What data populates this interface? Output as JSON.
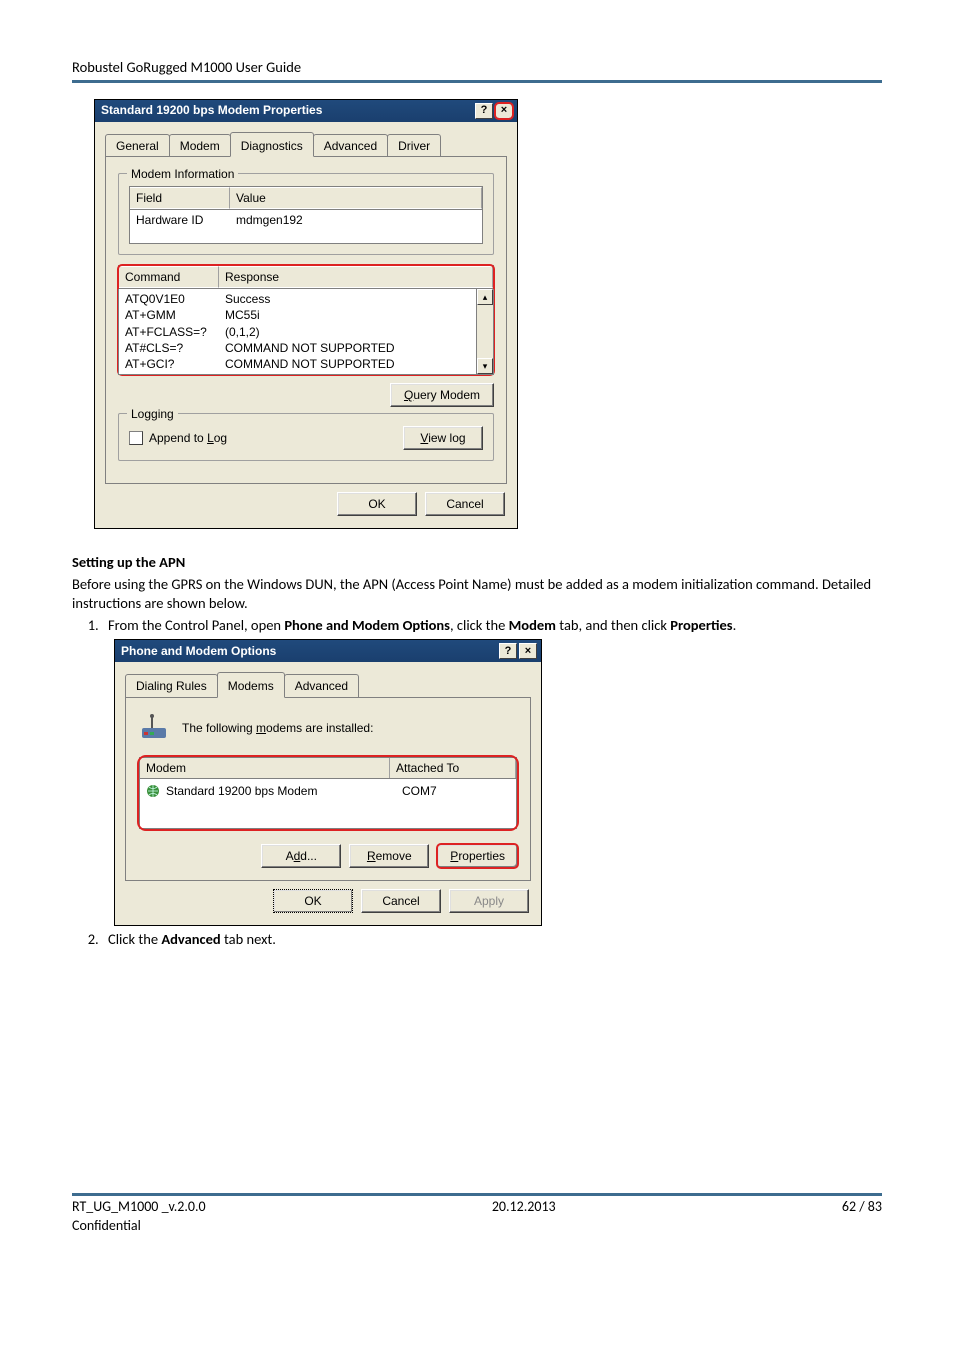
{
  "header": "Robustel GoRugged M1000 User Guide",
  "dialog1": {
    "title": "Standard 19200 bps Modem Properties",
    "tabs": [
      "General",
      "Modem",
      "Diagnostics",
      "Advanced",
      "Driver"
    ],
    "active_tab": "Diagnostics",
    "group_modem_info": "Modem Information",
    "field_hdr": "Field",
    "value_hdr": "Value",
    "hwid_field": "Hardware ID",
    "hwid_value": "mdmgen192",
    "cmd_hdr": "Command",
    "resp_hdr": "Response",
    "rows": [
      {
        "c": "ATQ0V1E0",
        "r": "Success"
      },
      {
        "c": "AT+GMM",
        "r": "MC55i"
      },
      {
        "c": "AT+FCLASS=?",
        "r": "(0,1,2)"
      },
      {
        "c": "AT#CLS=?",
        "r": "COMMAND NOT SUPPORTED"
      },
      {
        "c": "AT+GCI?",
        "r": "COMMAND NOT SUPPORTED"
      }
    ],
    "query_btn": "Query Modem",
    "group_logging": "Logging",
    "append_log": "Append to Log",
    "view_log": "View log",
    "ok": "OK",
    "cancel": "Cancel"
  },
  "section": {
    "heading": "Setting up the APN",
    "para": "Before using the GPRS on the Windows DUN, the APN (Access Point Name) must be added as a modem initialization command. Detailed instructions are shown below.",
    "step1_pre": "From the Control Panel, open ",
    "step1_b1": "Phone and Modem Options",
    "step1_mid1": ", click the ",
    "step1_b2": "Modem",
    "step1_mid2": " tab, and then click ",
    "step1_b3": "Properties",
    "step1_end": ".",
    "step2_pre": "Click the ",
    "step2_b": "Advanced",
    "step2_end": " tab next."
  },
  "dialog2": {
    "title": "Phone and Modem Options",
    "tabs": [
      "Dialing Rules",
      "Modems",
      "Advanced"
    ],
    "active_tab": "Modems",
    "installed_text": "The following modems are  installed:",
    "col_modem": "Modem",
    "col_attached": "Attached To",
    "modem_name": "Standard 19200 bps Modem",
    "modem_port": "COM7",
    "add": "Add...",
    "remove": "Remove",
    "properties": "Properties",
    "ok": "OK",
    "cancel": "Cancel",
    "apply": "Apply"
  },
  "footer": {
    "left": "RT_UG_M1000 _v.2.0.0",
    "left2": "Confidential",
    "center": "20.12.2013",
    "right": "62 / 83"
  }
}
